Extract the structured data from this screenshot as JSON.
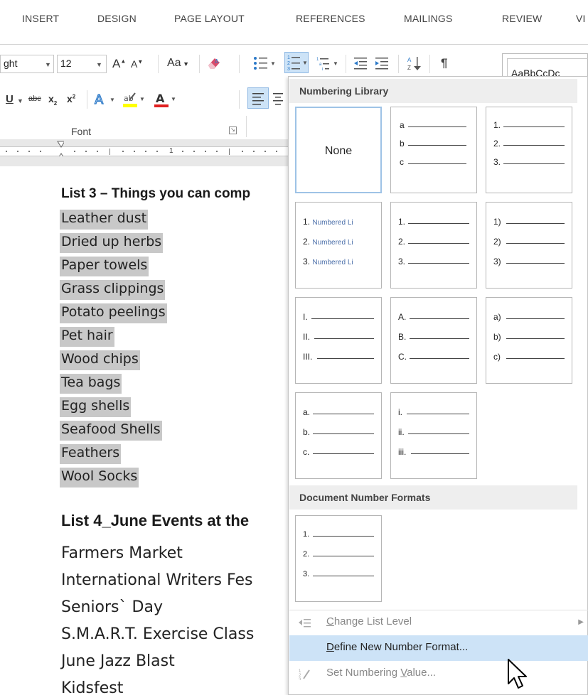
{
  "tabs": [
    "INSERT",
    "DESIGN",
    "PAGE LAYOUT",
    "REFERENCES",
    "MAILINGS",
    "REVIEW",
    "VI"
  ],
  "ribbon": {
    "font_name_partial": "ght",
    "font_size": "12",
    "grow_font": "A",
    "shrink_font": "A",
    "change_case": "Aa",
    "underline": "U",
    "strikethrough": "abc",
    "subscript": "x",
    "superscript": "x",
    "text_effects": "A",
    "highlight": "ab",
    "font_color": "A",
    "font_group_label": "Font",
    "pilcrow": "¶",
    "style_preview": "AaBbCcDc"
  },
  "ruler": {
    "number": "1"
  },
  "document": {
    "list3_heading": "List 3 – Things you can comp",
    "list3_items": [
      "Leather dust",
      "Dried up herbs",
      "Paper towels",
      "Grass clippings",
      "Potato peelings",
      "Pet hair",
      "Wood chips",
      "Tea bags",
      "Egg shells",
      "Seafood Shells",
      "Feathers",
      "Wool Socks"
    ],
    "list4_heading": "List 4_June Events at the",
    "list4_items": [
      "Farmers Market",
      "International Writers Fes",
      "Seniors` Day",
      "S.M.A.R.T. Exercise Class",
      "June Jazz Blast",
      "Kidsfest"
    ]
  },
  "menu": {
    "library_header": "Numbering Library",
    "none_label": "None",
    "tiles": [
      [
        "a",
        "b",
        "c"
      ],
      [
        "1.",
        "2.",
        "3."
      ],
      [
        "1.",
        "2.",
        "3."
      ],
      [
        "1.",
        "2.",
        "3."
      ],
      [
        "1)",
        "2)",
        "3)"
      ],
      [
        "I.",
        "II.",
        "III."
      ],
      [
        "A.",
        "B.",
        "C."
      ],
      [
        "a)",
        "b)",
        "c)"
      ],
      [
        "a.",
        "b.",
        "c."
      ],
      [
        "i.",
        "ii.",
        "iii."
      ]
    ],
    "numbered_label": "Numbered Li",
    "doc_formats_header": "Document Number Formats",
    "doc_tile": [
      "1.",
      "2.",
      "3."
    ],
    "change_level_a": "C",
    "change_level_b": "hange List Level",
    "define_new_a": "D",
    "define_new_b": "efine New Number Format...",
    "set_value_a": "Set Numbering ",
    "set_value_b": "V",
    "set_value_c": "alue..."
  },
  "colors": {
    "selection": "#c8c8c8",
    "hover": "#cde3f7",
    "selected_tile_border": "#9ec3e6",
    "header_bg": "#eeeeee"
  }
}
